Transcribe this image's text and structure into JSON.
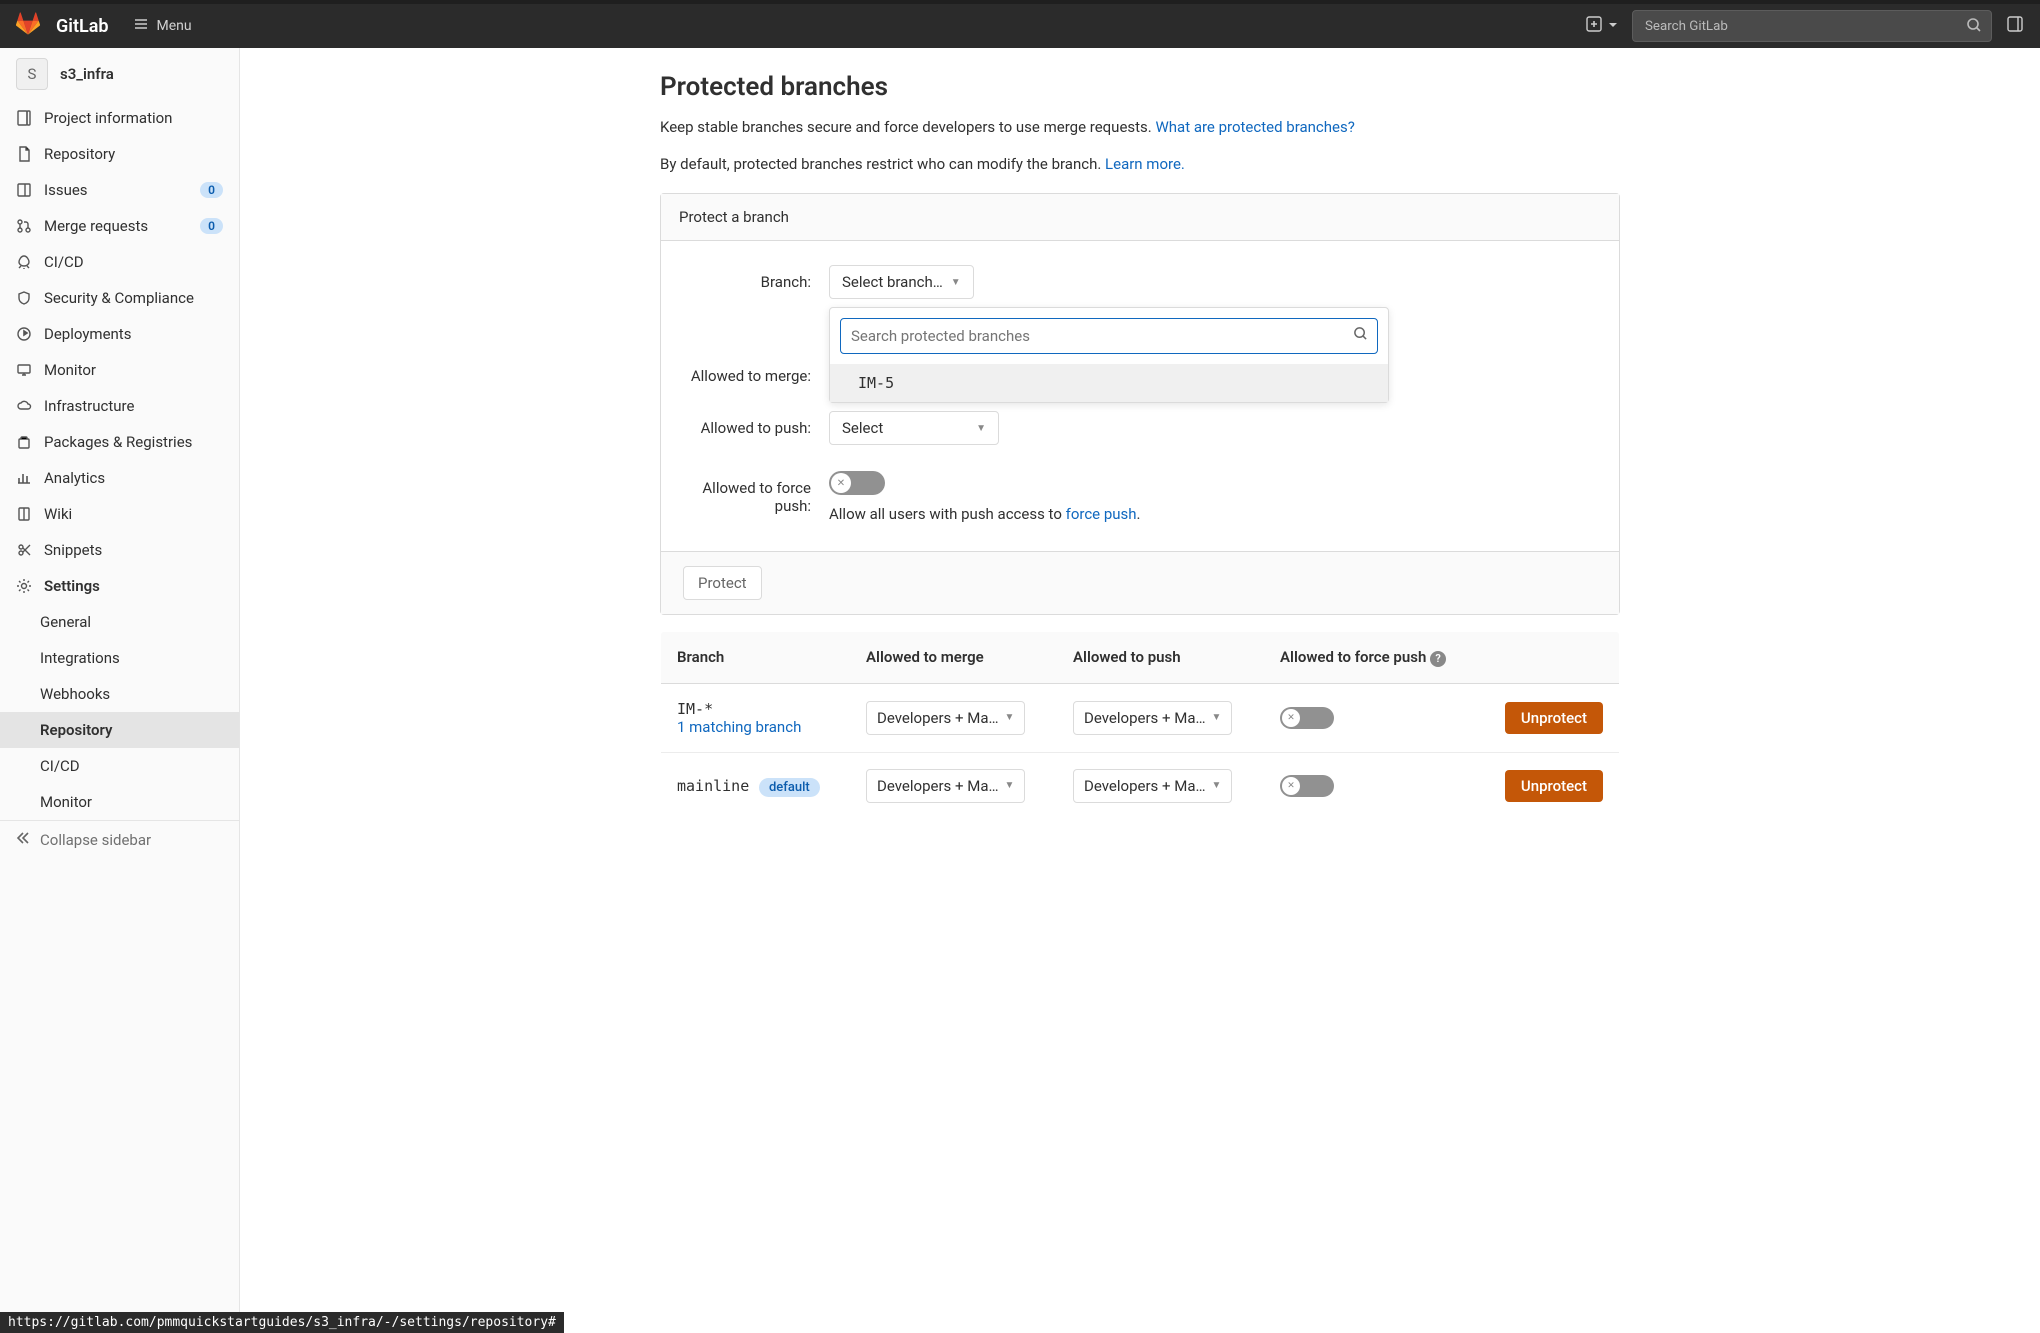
{
  "navbar": {
    "brand": "GitLab",
    "menu_label": "Menu",
    "search_placeholder": "Search GitLab"
  },
  "sidebar": {
    "project_initial": "S",
    "project_name": "s3_infra",
    "items": [
      {
        "label": "Project information"
      },
      {
        "label": "Repository"
      },
      {
        "label": "Issues",
        "count": "0"
      },
      {
        "label": "Merge requests",
        "count": "0"
      },
      {
        "label": "CI/CD"
      },
      {
        "label": "Security & Compliance"
      },
      {
        "label": "Deployments"
      },
      {
        "label": "Monitor"
      },
      {
        "label": "Infrastructure"
      },
      {
        "label": "Packages & Registries"
      },
      {
        "label": "Analytics"
      },
      {
        "label": "Wiki"
      },
      {
        "label": "Snippets"
      },
      {
        "label": "Settings"
      }
    ],
    "sub_items": [
      {
        "label": "General"
      },
      {
        "label": "Integrations"
      },
      {
        "label": "Webhooks"
      },
      {
        "label": "Repository"
      },
      {
        "label": "CI/CD"
      },
      {
        "label": "Monitor"
      }
    ],
    "collapse_label": "Collapse sidebar"
  },
  "main": {
    "title": "Protected branches",
    "desc_prefix": "Keep stable branches secure and force developers to use merge requests. ",
    "desc_link": "What are protected branches?",
    "desc2_prefix": "By default, protected branches restrict who can modify the branch. ",
    "desc2_link": "Learn more.",
    "panel_title": "Protect a branch",
    "form": {
      "branch_label": "Branch:",
      "branch_select": "Select branch…",
      "branch_search_placeholder": "Search protected branches",
      "branch_option": "IM-5",
      "merge_label": "Allowed to merge:",
      "push_label": "Allowed to push:",
      "push_select": "Select",
      "force_label": "Allowed to force push:",
      "force_helper_prefix": "Allow all users with push access to ",
      "force_helper_link": "force push",
      "force_helper_suffix": "."
    },
    "protect_btn": "Protect",
    "table": {
      "headers": {
        "branch": "Branch",
        "merge": "Allowed to merge",
        "push": "Allowed to push",
        "force": "Allowed to force push"
      },
      "rows": [
        {
          "name": "IM-*",
          "sub_link": "1 matching branch",
          "merge": "Developers + Ma…",
          "push": "Developers + Ma…",
          "unprotect": "Unprotect"
        },
        {
          "name": "mainline",
          "badge": "default",
          "merge": "Developers + Ma…",
          "push": "Developers + Ma…",
          "unprotect": "Unprotect"
        }
      ]
    }
  },
  "status_url": "https://gitlab.com/pmmquickstartguides/s3_infra/-/settings/repository#"
}
